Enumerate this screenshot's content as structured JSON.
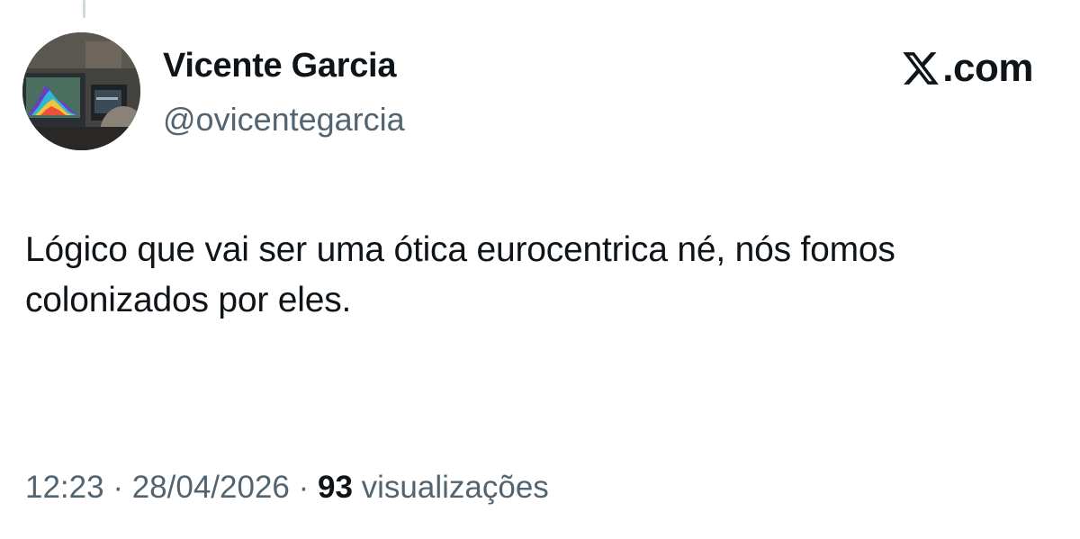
{
  "author": {
    "name": "Vicente Garcia",
    "handle": "@ovicentegarcia"
  },
  "brand": {
    "icon": "x-logo-icon",
    "text": ".com"
  },
  "tweet": {
    "text": "Lógico que vai ser uma ótica eurocentrica né, nós fomos colonizados por eles."
  },
  "meta": {
    "time": "12:23",
    "separator": " · ",
    "date": "28/04/2026",
    "views_count": "93",
    "views_label": "visualizações"
  }
}
